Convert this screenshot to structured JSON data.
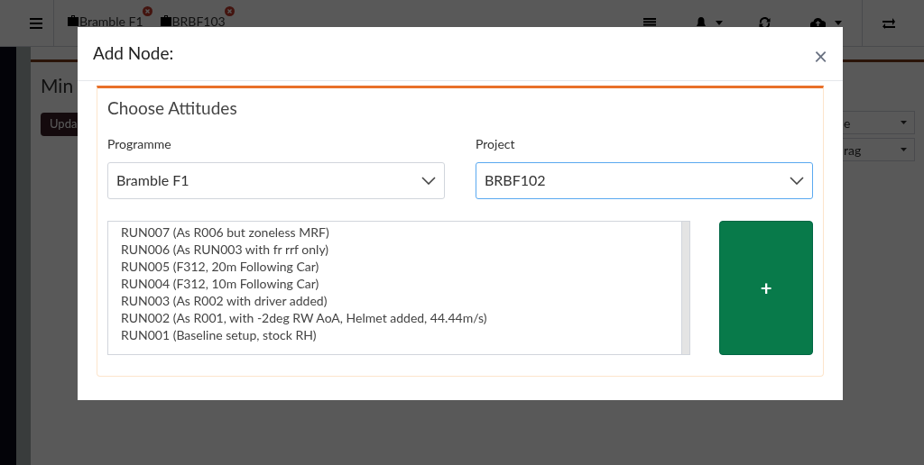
{
  "top_bar": {
    "tabs": [
      {
        "label": "Bramble F1"
      },
      {
        "label": "BRBF103"
      }
    ]
  },
  "page": {
    "title": "Min",
    "update_button": "Upda",
    "selects": [
      "e",
      "rag"
    ]
  },
  "modal": {
    "title": "Add Node:",
    "close": "×",
    "card": {
      "title": "Choose Attitudes",
      "selects": [
        {
          "label": "Programme",
          "value": "Bramble F1",
          "focused": false
        },
        {
          "label": "Project",
          "value": "BRBF102",
          "focused": true
        }
      ],
      "runs": [
        "RUN007 (As R006 but zoneless MRF)",
        "RUN006 (As RUN003 with fr rrf only)",
        "RUN005 (F312, 20m Following Car)",
        "RUN004 (F312, 10m Following Car)",
        "RUN003 (As R002 with driver added)",
        "RUN002 (As R001, with -2deg RW AoA, Helmet added, 44.44m/s)",
        "RUN001 (Baseline setup, stock RH)"
      ],
      "add_button": "+"
    }
  }
}
